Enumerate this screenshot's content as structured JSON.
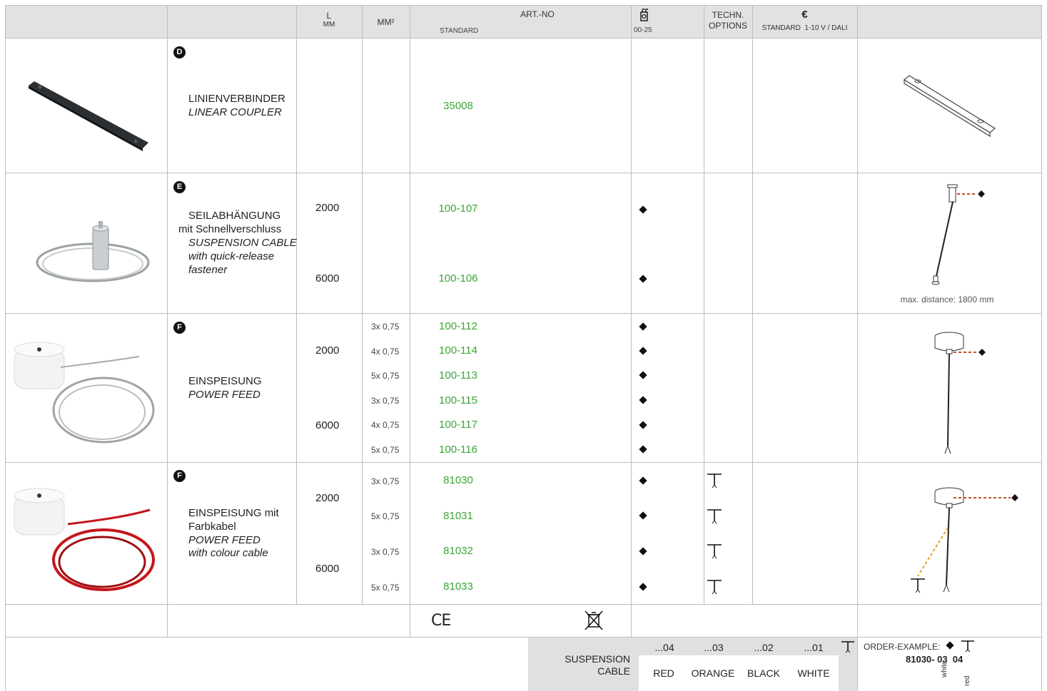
{
  "header": {
    "l_label": "L",
    "l_unit": "MM",
    "mm2_label": "MM²",
    "artno_label": "ART.-NO",
    "artno_sub": "STANDARD",
    "colour_range": "00-25",
    "techn_line1": "TECHN.",
    "techn_line2": "OPTIONS",
    "euro_symbol": "€",
    "price_sub": "STANDARD  1-10 V / DALI"
  },
  "rows": {
    "coupler": {
      "badge": "D",
      "name_de": "LINIENVERBINDER",
      "name_en": "LINEAR COUPLER",
      "art": "35008"
    },
    "cable": {
      "badge": "E",
      "name_de_1": "SEILABHÄNGUNG",
      "name_de_2": "mit Schnellverschluss",
      "name_en_1": "SUSPENSION CABLE",
      "name_en_2": "with quick-release",
      "name_en_3": "fastener",
      "len_1": "2000",
      "len_2": "6000",
      "art_1": "100-107",
      "art_2": "100-106",
      "note": "max. distance: 1800 mm"
    },
    "feed": {
      "badge": "F",
      "name_de": "EINSPEISUNG",
      "name_en": "POWER FEED",
      "len_1": "2000",
      "len_2": "6000",
      "items": [
        {
          "mm2": "3x 0,75",
          "art": "100-112"
        },
        {
          "mm2": "4x 0,75",
          "art": "100-114"
        },
        {
          "mm2": "5x 0,75",
          "art": "100-113"
        },
        {
          "mm2": "3x 0,75",
          "art": "100-115"
        },
        {
          "mm2": "4x 0,75",
          "art": "100-117"
        },
        {
          "mm2": "5x 0,75",
          "art": "100-116"
        }
      ]
    },
    "feed_colour": {
      "badge": "F",
      "name_de_1": "EINSPEISUNG mit",
      "name_de_2": "Farbkabel",
      "name_en_1": "POWER FEED",
      "name_en_2": "with colour cable",
      "len_1": "2000",
      "len_2": "6000",
      "items": [
        {
          "mm2": "3x 0,75",
          "art": "81030"
        },
        {
          "mm2": "5x 0,75",
          "art": "81031"
        },
        {
          "mm2": "3x 0,75",
          "art": "81032"
        },
        {
          "mm2": "5x 0,75",
          "art": "81033"
        }
      ]
    }
  },
  "footer": {
    "ce_mark": "CE",
    "suspension_1": "SUSPENSION",
    "suspension_2": "CABLE",
    "codes": [
      "...04",
      "...03",
      "...02",
      "...01"
    ],
    "colours": [
      "RED",
      "ORANGE",
      "BLACK",
      "WHITE"
    ],
    "order_label": "ORDER-EXAMPLE:",
    "order_code": "81030- 03  04",
    "order_note_1": "white",
    "order_note_2": "red"
  },
  "colors": {
    "art_number": "#3aa535",
    "header_bg": "#e2e2e2",
    "dashed_red": "#c0532a",
    "dashed_orange": "#f0a020"
  }
}
